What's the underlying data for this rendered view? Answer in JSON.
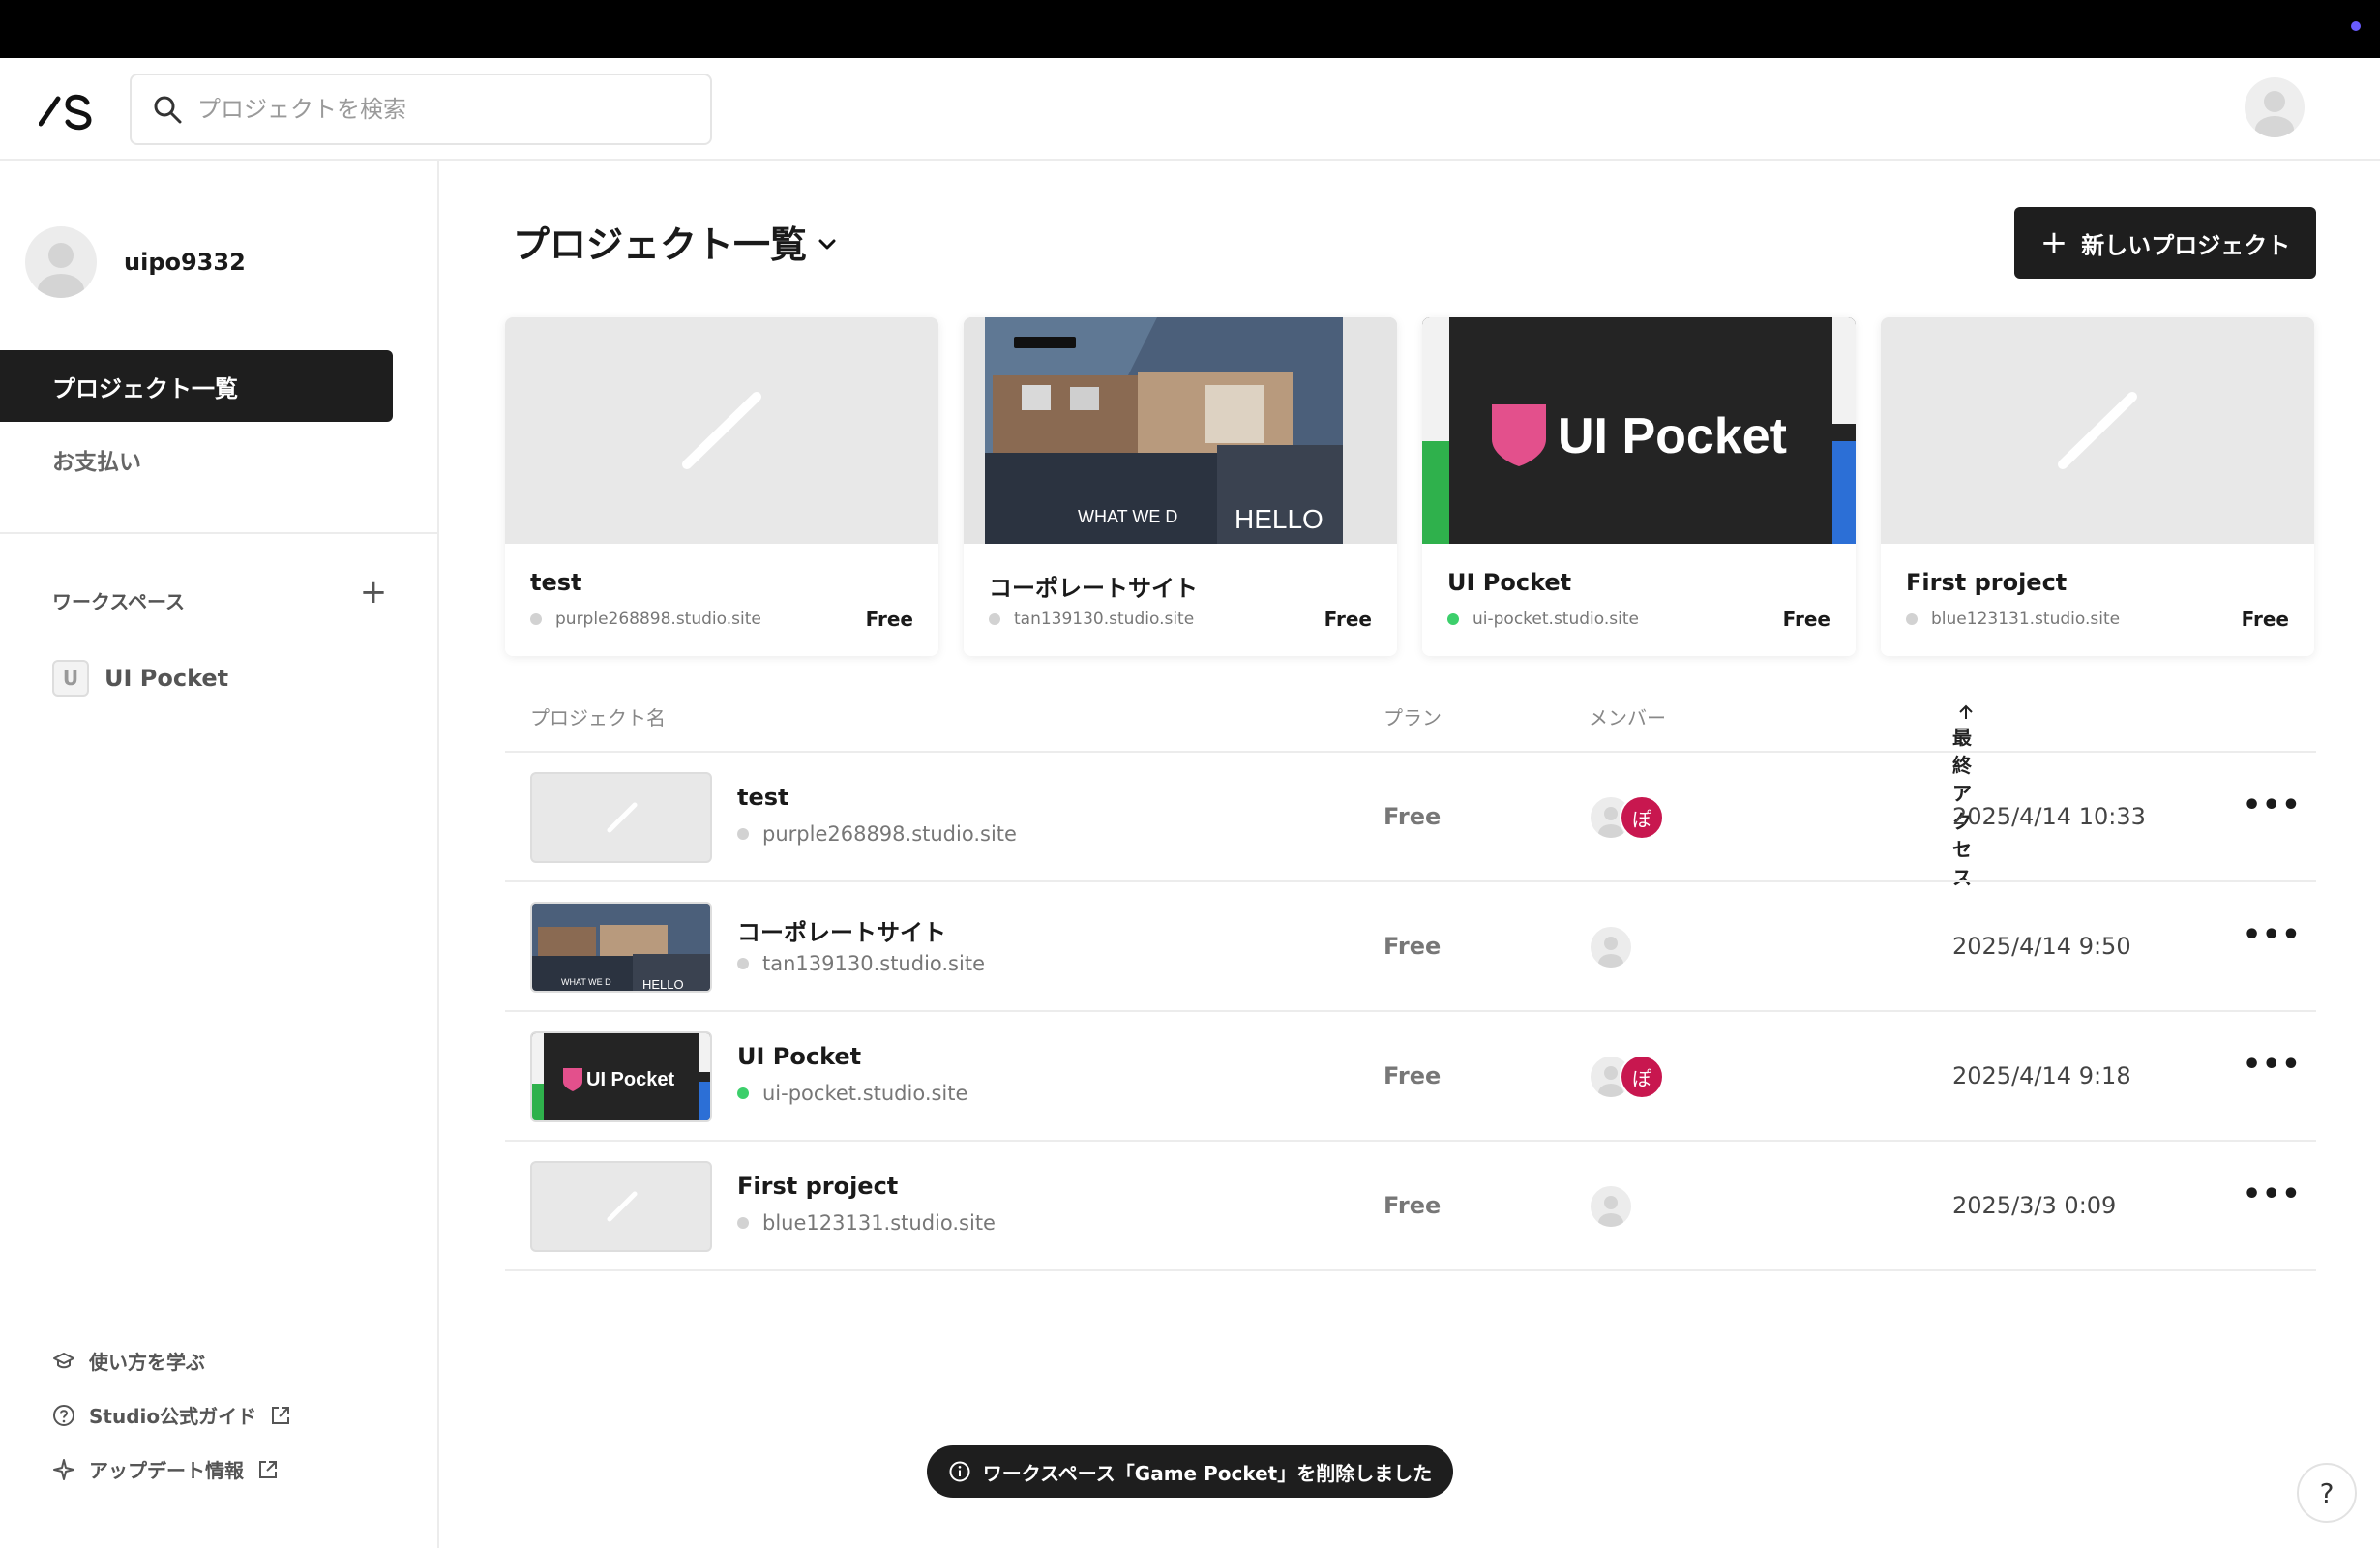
{
  "header": {
    "search_placeholder": "プロジェクトを検索"
  },
  "sidebar": {
    "user_name": "uipo9332",
    "nav_active": "プロジェクト一覧",
    "nav_payment": "お支払い",
    "workspace_heading": "ワークスペース",
    "workspace_item": {
      "badge": "U",
      "label": "UI Pocket"
    },
    "footer": {
      "learn": "使い方を学ぶ",
      "guide": "Studio公式ガイド",
      "updates": "アップデート情報"
    }
  },
  "main": {
    "title": "プロジェクト一覧",
    "new_project_label": "新しいプロジェクト",
    "cards": [
      {
        "name": "test",
        "domain": "purple268898.studio.site",
        "plan": "Free",
        "status": "gray"
      },
      {
        "name": "コーポレートサイト",
        "domain": "tan139130.studio.site",
        "plan": "Free",
        "status": "gray",
        "thumb_text_a": "WHAT WE D",
        "thumb_text_b": "HELLO"
      },
      {
        "name": "UI Pocket",
        "domain": "ui-pocket.studio.site",
        "plan": "Free",
        "status": "green",
        "thumb_text": "UI Pocket"
      },
      {
        "name": "First project",
        "domain": "blue123131.studio.site",
        "plan": "Free",
        "status": "gray"
      }
    ],
    "table": {
      "col_name": "プロジェクト名",
      "col_plan": "プラン",
      "col_members": "メンバー",
      "col_access": "最終アクセス",
      "rows": [
        {
          "name": "test",
          "domain": "purple268898.studio.site",
          "plan": "Free",
          "date": "2025/4/14 10:33",
          "member_badge": "ぽ"
        },
        {
          "name": "コーポレートサイト",
          "domain": "tan139130.studio.site",
          "plan": "Free",
          "date": "2025/4/14 9:50",
          "thumb_text_a": "WHAT WE D",
          "thumb_text_b": "HELLO"
        },
        {
          "name": "UI Pocket",
          "domain": "ui-pocket.studio.site",
          "plan": "Free",
          "date": "2025/4/14 9:18",
          "member_badge": "ぽ",
          "thumb_text": "UI Pocket"
        },
        {
          "name": "First project",
          "domain": "blue123131.studio.site",
          "plan": "Free",
          "date": "2025/3/3 0:09"
        }
      ],
      "more_label": "•••"
    }
  },
  "toast": {
    "message": "ワークスペース「Game Pocket」を削除しました"
  },
  "help": {
    "label": "?"
  },
  "colors": {
    "accent_dark": "#1e1e1e",
    "member_pink": "#c8174f",
    "status_green": "#3ccf6b",
    "status_gray": "#d2d2d2"
  }
}
